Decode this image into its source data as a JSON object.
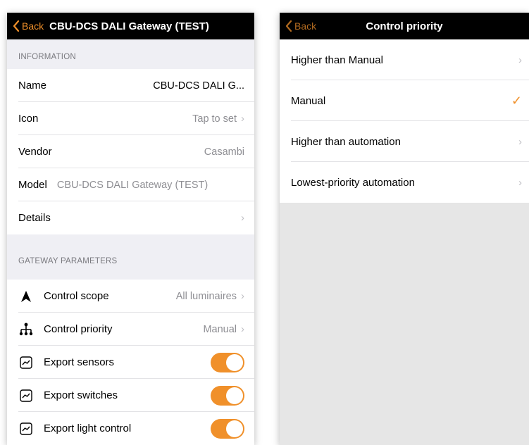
{
  "left": {
    "navbar": {
      "back_label": "Back",
      "title": "CBU-DCS DALI Gateway (TEST)"
    },
    "information": {
      "header": "INFORMATION",
      "rows": {
        "name": {
          "label": "Name",
          "value": "CBU-DCS DALI G..."
        },
        "icon": {
          "label": "Icon",
          "value": "Tap to set"
        },
        "vendor": {
          "label": "Vendor",
          "value": "Casambi"
        },
        "model": {
          "label": "Model",
          "value": "CBU-DCS DALI Gateway (TEST)"
        },
        "details": {
          "label": "Details"
        }
      }
    },
    "gateway": {
      "header": "GATEWAY PARAMETERS",
      "rows": {
        "control_scope": {
          "label": "Control scope",
          "value": "All luminaires",
          "icon": "navigation-arrow-icon"
        },
        "control_priority": {
          "label": "Control priority",
          "value": "Manual",
          "icon": "hierarchy-icon"
        },
        "export_sensors": {
          "label": "Export sensors",
          "enabled": true,
          "icon": "chart-line-icon"
        },
        "export_switches": {
          "label": "Export switches",
          "enabled": true,
          "icon": "chart-line-icon"
        },
        "export_light": {
          "label": "Export light control",
          "enabled": true,
          "icon": "chart-line-icon"
        }
      }
    }
  },
  "right": {
    "navbar": {
      "back_label": "Back",
      "title": "Control priority"
    },
    "options": [
      {
        "label": "Higher than Manual",
        "selected": false
      },
      {
        "label": "Manual",
        "selected": true
      },
      {
        "label": "Higher than automation",
        "selected": false
      },
      {
        "label": "Lowest-priority automation",
        "selected": false
      }
    ]
  },
  "colors": {
    "accent": "#f0902a",
    "navbar": "#000000",
    "background": "#efeff4"
  }
}
